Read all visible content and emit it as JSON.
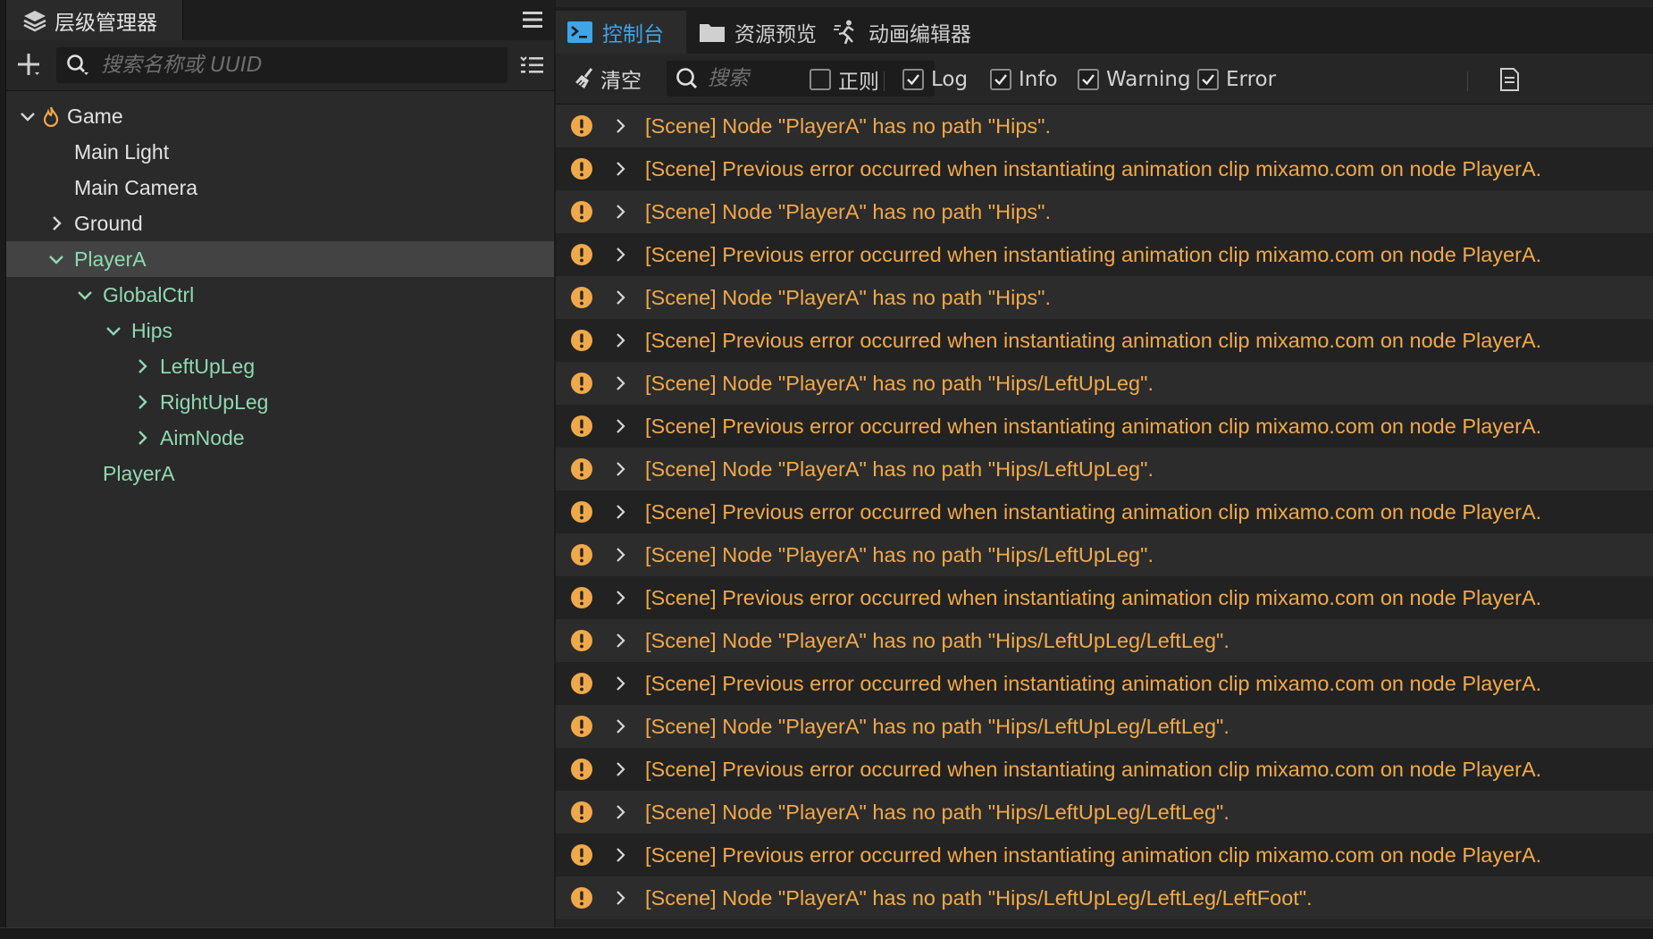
{
  "hierarchy": {
    "title": "层级管理器",
    "search_placeholder": "搜索名称或 UUID",
    "nodes": [
      {
        "label": "Game",
        "depth": 0,
        "arrow": "down",
        "color": "white",
        "icon": "fire-icon",
        "selected": false
      },
      {
        "label": "Main Light",
        "depth": 1,
        "arrow": "none",
        "color": "white",
        "selected": false
      },
      {
        "label": "Main Camera",
        "depth": 1,
        "arrow": "none",
        "color": "white",
        "selected": false
      },
      {
        "label": "Ground",
        "depth": 1,
        "arrow": "right",
        "color": "white",
        "selected": false
      },
      {
        "label": "PlayerA",
        "depth": 1,
        "arrow": "down",
        "color": "green",
        "selected": true
      },
      {
        "label": "GlobalCtrl",
        "depth": 2,
        "arrow": "down",
        "color": "green",
        "selected": false
      },
      {
        "label": "Hips",
        "depth": 3,
        "arrow": "down",
        "color": "green",
        "selected": false
      },
      {
        "label": "LeftUpLeg",
        "depth": 4,
        "arrow": "right",
        "color": "green",
        "selected": false
      },
      {
        "label": "RightUpLeg",
        "depth": 4,
        "arrow": "right",
        "color": "green",
        "selected": false
      },
      {
        "label": "AimNode",
        "depth": 4,
        "arrow": "right",
        "color": "green",
        "selected": false
      },
      {
        "label": "PlayerA",
        "depth": 2,
        "arrow": "none",
        "color": "green",
        "selected": false
      }
    ]
  },
  "console": {
    "tabs": [
      {
        "label": "控制台",
        "icon": "terminal-icon",
        "active": true
      },
      {
        "label": "资源预览",
        "icon": "folder-icon",
        "active": false
      },
      {
        "label": "动画编辑器",
        "icon": "running-figure-icon",
        "active": false
      }
    ],
    "clear_label": "清空",
    "search_placeholder": "搜索",
    "filters": [
      {
        "label": "正则",
        "checked": false
      },
      {
        "label": "Log",
        "checked": true
      },
      {
        "label": "Info",
        "checked": true
      },
      {
        "label": "Warning",
        "checked": true
      },
      {
        "label": "Error",
        "checked": true
      }
    ],
    "messages": [
      "[Scene] Node \"PlayerA\" has no path \"Hips\".",
      "[Scene] Previous error occurred when instantiating animation clip mixamo.com on node PlayerA.",
      "[Scene] Node \"PlayerA\" has no path \"Hips\".",
      "[Scene] Previous error occurred when instantiating animation clip mixamo.com on node PlayerA.",
      "[Scene] Node \"PlayerA\" has no path \"Hips\".",
      "[Scene] Previous error occurred when instantiating animation clip mixamo.com on node PlayerA.",
      "[Scene] Node \"PlayerA\" has no path \"Hips/LeftUpLeg\".",
      "[Scene] Previous error occurred when instantiating animation clip mixamo.com on node PlayerA.",
      "[Scene] Node \"PlayerA\" has no path \"Hips/LeftUpLeg\".",
      "[Scene] Previous error occurred when instantiating animation clip mixamo.com on node PlayerA.",
      "[Scene] Node \"PlayerA\" has no path \"Hips/LeftUpLeg\".",
      "[Scene] Previous error occurred when instantiating animation clip mixamo.com on node PlayerA.",
      "[Scene] Node \"PlayerA\" has no path \"Hips/LeftUpLeg/LeftLeg\".",
      "[Scene] Previous error occurred when instantiating animation clip mixamo.com on node PlayerA.",
      "[Scene] Node \"PlayerA\" has no path \"Hips/LeftUpLeg/LeftLeg\".",
      "[Scene] Previous error occurred when instantiating animation clip mixamo.com on node PlayerA.",
      "[Scene] Node \"PlayerA\" has no path \"Hips/LeftUpLeg/LeftLeg\".",
      "[Scene] Previous error occurred when instantiating animation clip mixamo.com on node PlayerA.",
      "[Scene] Node \"PlayerA\" has no path \"Hips/LeftUpLeg/LeftLeg/LeftFoot\"."
    ]
  },
  "colors": {
    "accent": "#3fa5e6",
    "warning": "#f0a94a",
    "node_green": "#8fd9b1",
    "selection": "#434343"
  }
}
